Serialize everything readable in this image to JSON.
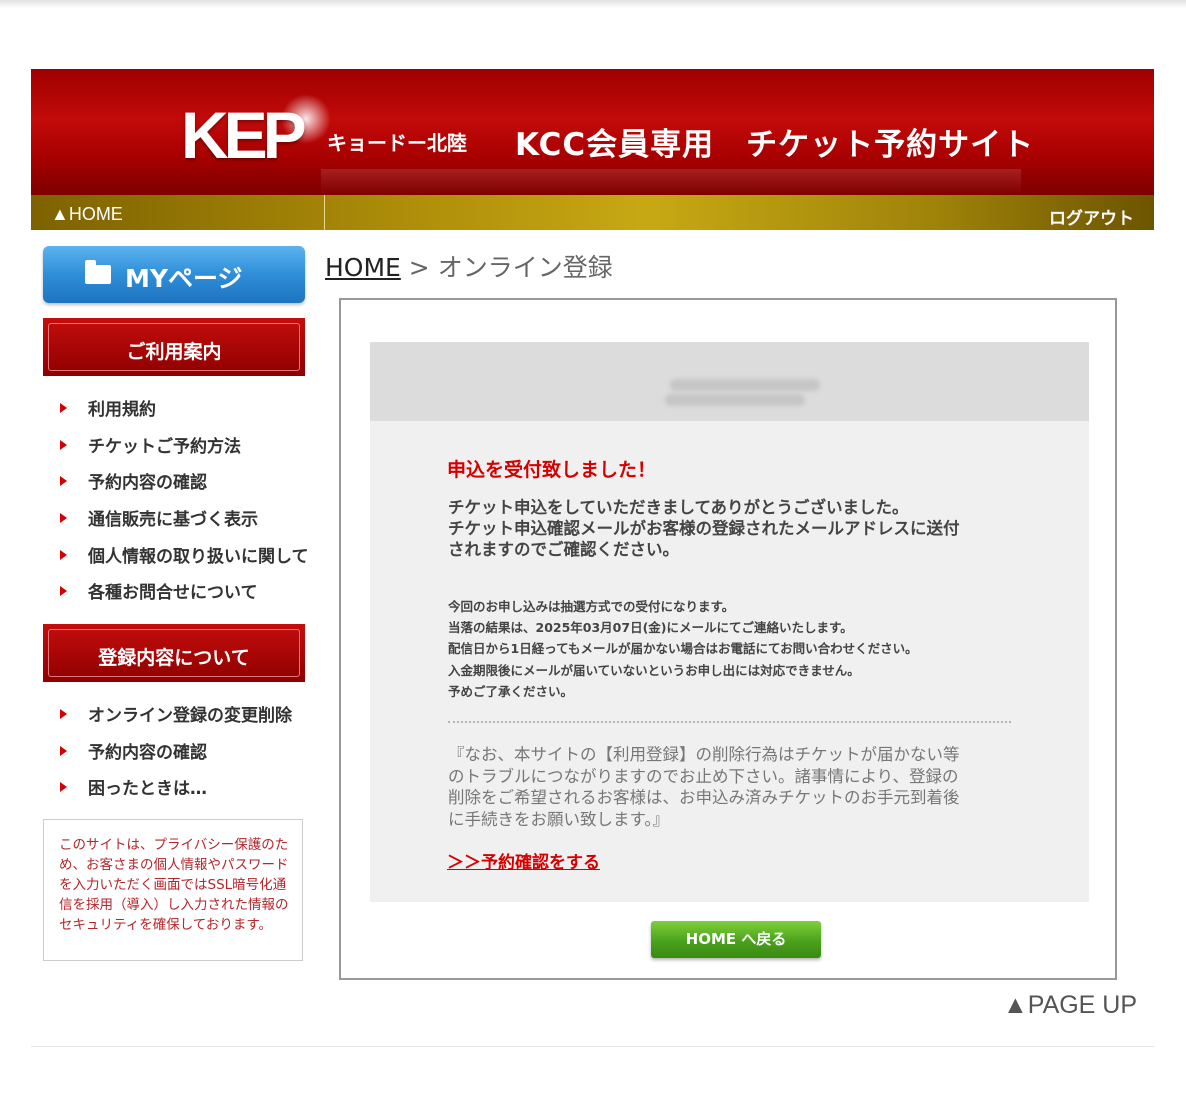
{
  "header": {
    "logo": "KEP",
    "company": "キョードー北陸",
    "site_title": "KCC会員専用　チケット予約サイト"
  },
  "nav": {
    "home": "▲HOME",
    "logout": "ログアウト"
  },
  "sidebar": {
    "mypage": "MYページ",
    "section1_title": "ご利用案内",
    "section1_items": [
      {
        "label": "利用規約"
      },
      {
        "label": "チケットご予約方法"
      },
      {
        "label": "予約内容の確認"
      },
      {
        "label": "通信販売に基づく表示"
      },
      {
        "label": "個人情報の取り扱いに関して"
      },
      {
        "label": "各種お問合せについて"
      }
    ],
    "section2_title": "登録内容について",
    "section2_items": [
      {
        "label": "オンライン登録の変更削除"
      },
      {
        "label": "予約内容の確認"
      },
      {
        "label": "困ったときは…"
      }
    ],
    "ssl_notice": "このサイトは、プライバシー保護のため、お客さまの個人情報やパスワードを入力いただく画面ではSSL暗号化通信を採用（導入）し入力された情報のセキュリティを確保しております。"
  },
  "breadcrumb": {
    "home": "HOME",
    "separator": " > ",
    "current": "オンライン登録"
  },
  "main": {
    "accepted_title": "申込を受付致しました！",
    "thanks_text": "チケット申込をしていただきましてありがとうございました。\nチケット申込確認メールがお客様の登録されたメールアドレスに送付\nされますのでご確認ください。",
    "lottery_notice": "今回のお申し込みは抽選方式での受付になります。\n当落の結果は、2025年03月07日(金)にメールにてご連絡いたします。\n配信日から1日経ってもメールが届かない場合はお電話にてお問い合わせください。\n入金期限後にメールが届いていないというお申し出には対応できません。\n予めご了承ください。",
    "caution_text": "『なお、本サイトの【利用登録】の削除行為はチケットが届かない等\nのトラブルにつながりますのでお止め下さい。諸事情により、登録の\n削除をご希望されるお客様は、お申込み済みチケットのお手元到着後\nに手続きをお願い致します。』",
    "confirm_link": "＞＞予約確認をする",
    "home_button": "HOME へ戻る"
  },
  "footer": {
    "page_up": "▲PAGE UP"
  }
}
